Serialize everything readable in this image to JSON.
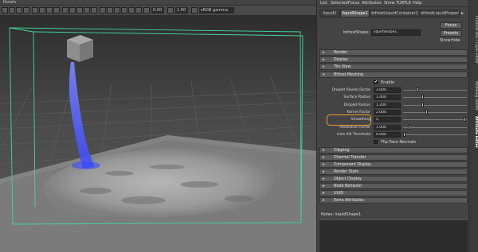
{
  "viewport": {
    "menu": [
      "Panels"
    ],
    "toolbar": {
      "value_1": "0.00",
      "value_2": "1.00",
      "colorspace": "sRGB gamma"
    }
  },
  "attribute_editor": {
    "menu": [
      "List",
      "Selected",
      "Focus",
      "Attributes",
      "Show",
      "TURTLE",
      "Help"
    ],
    "tabs": [
      "liquid1",
      "liquidShape1",
      "bifrostLiquidContainer1",
      "bifrostLiquidPropert"
    ],
    "active_tab": "liquidShape1",
    "shape_label": "bifrostShape:",
    "shape_value": "liquidShape1",
    "focus_label": "Focus",
    "presets_label": "Presets",
    "show_label": "Show",
    "hide_label": "Hide",
    "sections_top": [
      {
        "title": "Render",
        "expanded": false
      },
      {
        "title": "Display",
        "expanded": false
      },
      {
        "title": "Tile View",
        "expanded": false
      },
      {
        "title": "Bifrost Meshing",
        "expanded": true
      }
    ],
    "meshing": {
      "enable_label": "Enable",
      "enable_checked": true,
      "attributes": [
        {
          "label": "Droplet Reveal Factor",
          "value": "3.000",
          "level": 0.22
        },
        {
          "label": "Surface Radius",
          "value": "1.400",
          "level": 0.3
        },
        {
          "label": "Droplet Radius",
          "value": "1.200",
          "level": 0.3
        },
        {
          "label": "Kernel Factor",
          "value": "2.000",
          "level": 0.36
        },
        {
          "label": "Smoothing",
          "value": "5",
          "level": 0.99
        },
        {
          "label": "Resolution Factor",
          "value": "1.000",
          "level": 0.08
        },
        {
          "label": "Hole Kill Threshold",
          "value": "0.000",
          "level": 0.0
        }
      ],
      "flip_label": "Flip Face Normals",
      "flip_checked": false
    },
    "sections_bottom": [
      "Clipping",
      "Channel Transfer",
      "Component Display",
      "Render Stats",
      "Object Display",
      "Node Behavior",
      "UUID",
      "Extra Attributes"
    ],
    "notes_label": "Notes:  liquidShape1"
  },
  "dock_tabs": [
    "Channel Box / Layer Editor",
    "Modeling Toolkit",
    "Attribute Editor"
  ],
  "active_dock_tab": "Attribute Editor",
  "colors": {
    "highlight": "#f39a2b",
    "bounding_box": "#44d4a0",
    "particles": "#4a5fff"
  },
  "icons": [
    "grid-icon",
    "camera-icon",
    "shading-icon",
    "lighting-icon",
    "color-management-icon"
  ]
}
